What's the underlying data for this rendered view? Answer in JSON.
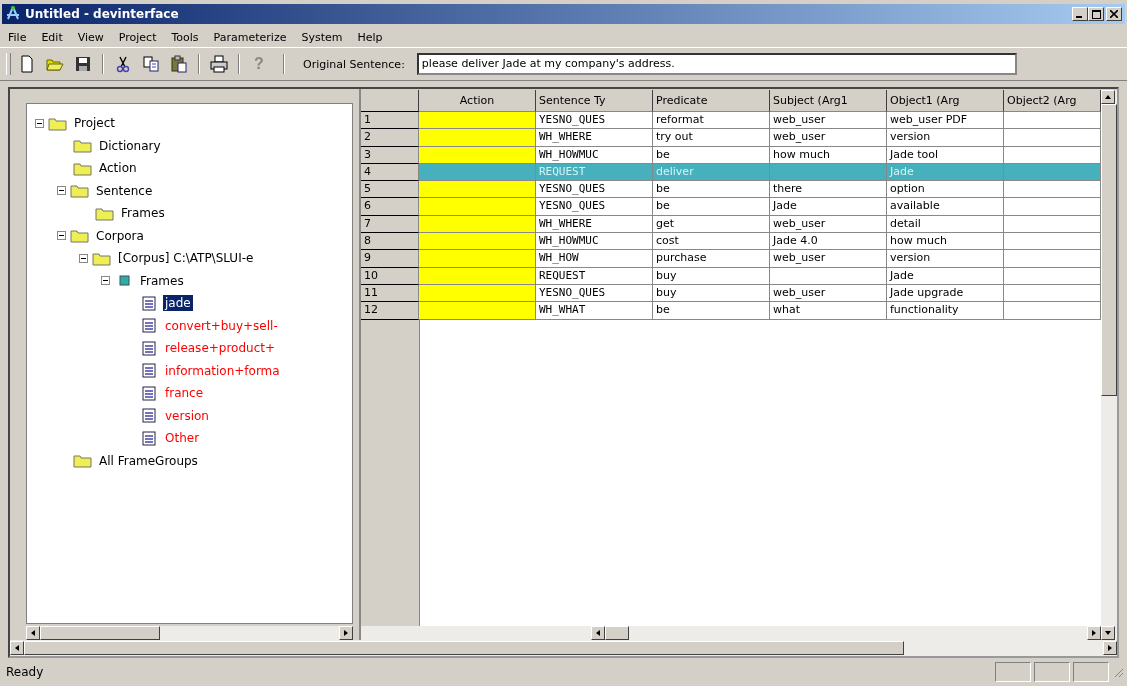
{
  "window": {
    "title": "Untitled - devinterface"
  },
  "menu": [
    "File",
    "Edit",
    "View",
    "Project",
    "Tools",
    "Parameterize",
    "System",
    "Help"
  ],
  "toolbar": {
    "help_label": "?",
    "sentence_label": "Original Sentence:",
    "sentence_value": "please deliver Jade at my company's address."
  },
  "tree": [
    {
      "label": "Project",
      "kind": "folder",
      "selected": false,
      "expanded": true,
      "children": [
        {
          "label": "Dictionary",
          "kind": "folder",
          "selected": false
        },
        {
          "label": "Action",
          "kind": "folder",
          "selected": false
        },
        {
          "label": "Sentence",
          "kind": "folder",
          "selected": false,
          "expanded": true,
          "children": [
            {
              "label": "Frames",
              "kind": "folder",
              "selected": false
            }
          ]
        },
        {
          "label": "Corpora",
          "kind": "folder",
          "selected": false,
          "expanded": true,
          "children": [
            {
              "label": "[Corpus] C:\\ATP\\SLUI-e",
              "kind": "folder",
              "selected": false,
              "expanded": true,
              "children": [
                {
                  "label": "Frames",
                  "kind": "set",
                  "selected": false,
                  "expanded": true,
                  "children": [
                    {
                      "label": "jade",
                      "kind": "frame",
                      "selected": true
                    },
                    {
                      "label": "convert+buy+sell-",
                      "kind": "frame",
                      "selected": false,
                      "color": "#ff0000"
                    },
                    {
                      "label": "release+product+",
                      "kind": "frame",
                      "selected": false,
                      "color": "#ff0000"
                    },
                    {
                      "label": "information+forma",
                      "kind": "frame",
                      "selected": false,
                      "color": "#ff0000"
                    },
                    {
                      "label": "france",
                      "kind": "frame",
                      "selected": false,
                      "color": "#ff0000"
                    },
                    {
                      "label": "version",
                      "kind": "frame",
                      "selected": false,
                      "color": "#ff0000"
                    },
                    {
                      "label": "Other",
                      "kind": "frame",
                      "selected": false,
                      "color": "#ff0000"
                    }
                  ]
                }
              ]
            }
          ]
        },
        {
          "label": "All FrameGroups",
          "kind": "folder",
          "selected": false
        }
      ]
    }
  ],
  "grid": {
    "columns": [
      "Action",
      "Sentence Ty",
      "Predicate",
      "Subject (Arg1",
      "Object1 (Arg",
      "Object2 (Arg"
    ],
    "rows": [
      {
        "number": "1",
        "selected": false,
        "sentence_type": "YESNO_QUES",
        "predicate": "reformat",
        "subject": "web_user",
        "object1": "web_user PDF"
      },
      {
        "number": "2",
        "selected": false,
        "sentence_type": "WH_WHERE",
        "predicate": "try out",
        "subject": "web_user",
        "object1": "version"
      },
      {
        "number": "3",
        "selected": false,
        "sentence_type": "WH_HOWMUC",
        "predicate": "be",
        "subject": "how much",
        "object1": "Jade tool"
      },
      {
        "number": "4",
        "selected": true,
        "sentence_type": "REQUEST",
        "predicate": "deliver",
        "object1": "Jade"
      },
      {
        "number": "5",
        "selected": false,
        "sentence_type": "YESNO_QUES",
        "predicate": "be",
        "subject": "there",
        "object1": "option"
      },
      {
        "number": "6",
        "selected": false,
        "sentence_type": "YESNO_QUES",
        "predicate": "be",
        "subject": "Jade",
        "object1": "available"
      },
      {
        "number": "7",
        "selected": false,
        "sentence_type": "WH_WHERE",
        "predicate": "get",
        "subject": "web_user",
        "object1": "detail"
      },
      {
        "number": "8",
        "selected": false,
        "sentence_type": "WH_HOWMUC",
        "predicate": "cost",
        "subject": "Jade 4.0",
        "object1": "how much"
      },
      {
        "number": "9",
        "selected": false,
        "sentence_type": "WH_HOW",
        "predicate": "purchase",
        "subject": "web_user",
        "object1": "version"
      },
      {
        "number": "10",
        "selected": false,
        "sentence_type": "REQUEST",
        "predicate": "buy",
        "object1": "Jade"
      },
      {
        "number": "11",
        "selected": false,
        "sentence_type": "YESNO_QUES",
        "predicate": "buy",
        "subject": "web_user",
        "object1": "Jade upgrade"
      },
      {
        "number": "12",
        "selected": false,
        "sentence_type": "WH_WHAT",
        "predicate": "be",
        "subject": "what",
        "object1": "functionality"
      }
    ]
  },
  "status_bar": {
    "text": "Ready"
  }
}
